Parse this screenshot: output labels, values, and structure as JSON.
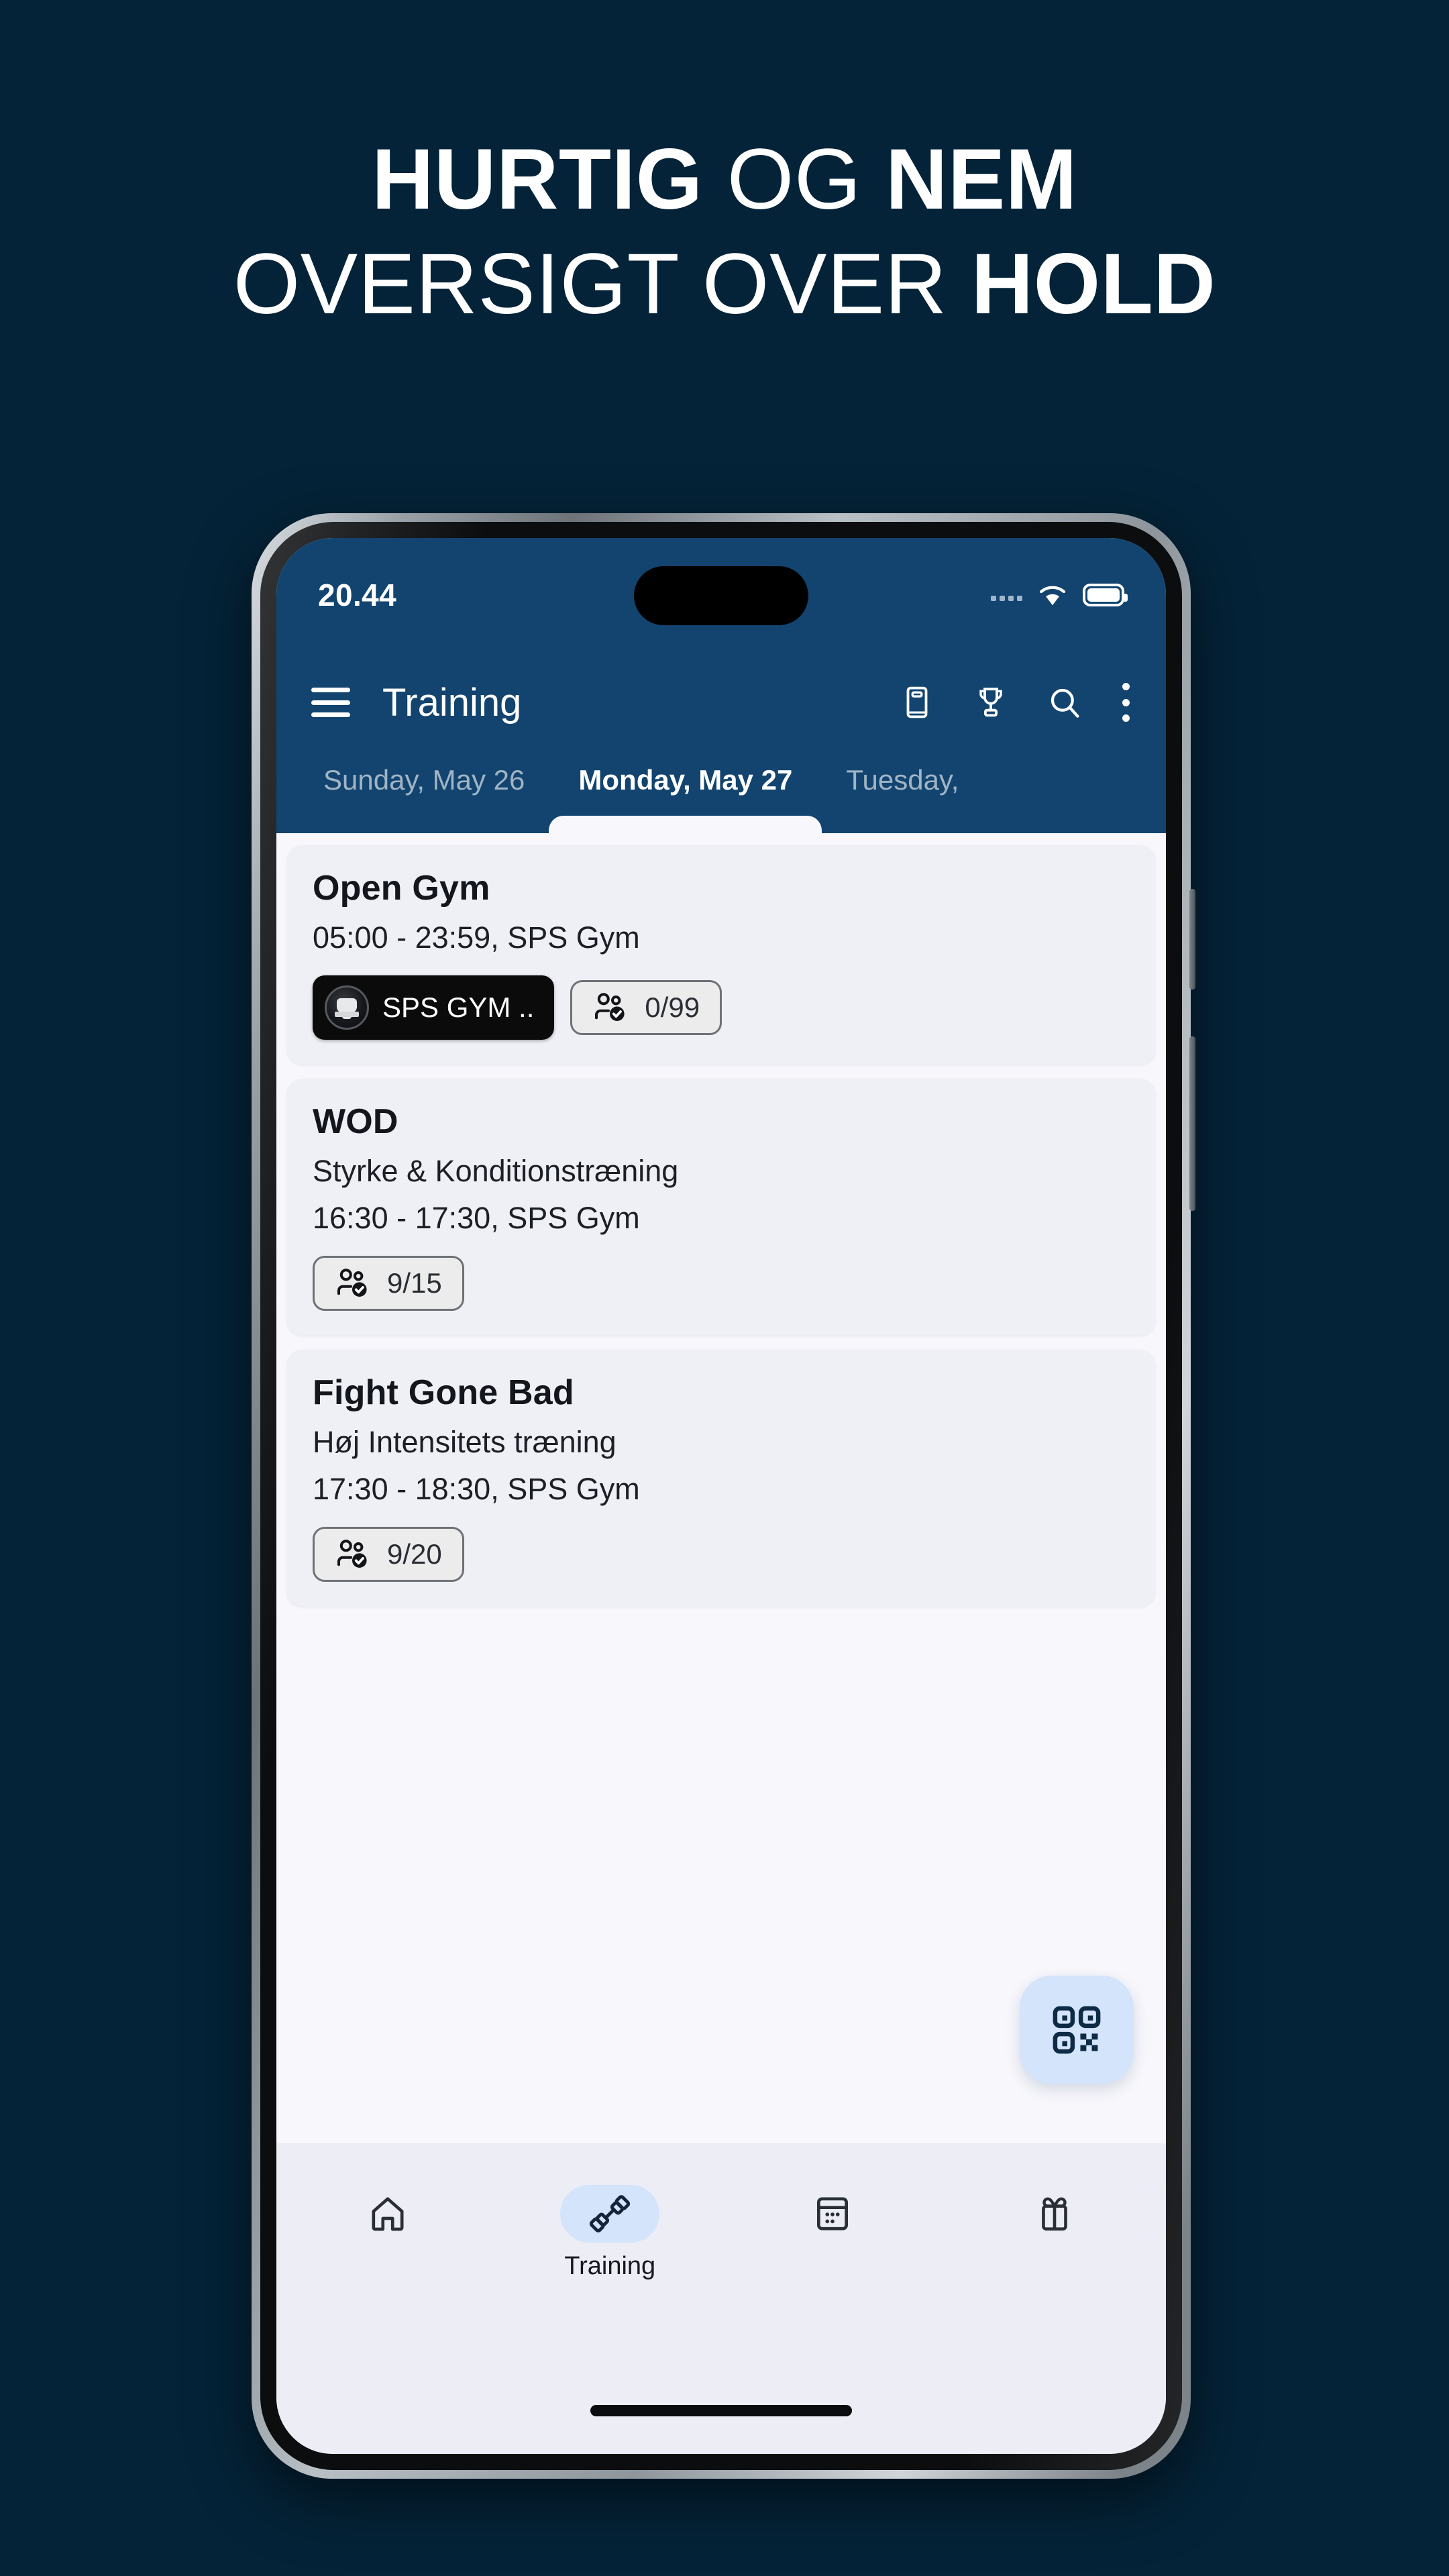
{
  "headline": {
    "line1_bold": "HURTIG",
    "line1_light": " OG ",
    "line1_bold2": "NEM",
    "line2_light": "OVERSIGT OVER ",
    "line2_bold": "HOLD"
  },
  "colors": {
    "page_background": "#042338",
    "appbar": "#12446F",
    "content_background": "#F7F7FC",
    "card_background": "#EFEFF6",
    "bottomnav_background": "#EDEDF5",
    "accent_light_blue": "#D3E4FB",
    "accent_icon_navy": "#0E2B45",
    "text_dark": "#13161C"
  },
  "statusbar": {
    "time": "20.44",
    "icons": [
      "signal-dots-icon",
      "wifi-icon",
      "battery-icon"
    ]
  },
  "appbar": {
    "menu_icon": "hamburger-menu-icon",
    "title": "Training",
    "actions": [
      {
        "icon": "journal-book-icon",
        "name": "journal-button"
      },
      {
        "icon": "trophy-icon",
        "name": "leaderboard-button"
      },
      {
        "icon": "search-icon",
        "name": "search-button"
      },
      {
        "icon": "overflow-menu-icon",
        "name": "overflow-menu-button"
      }
    ]
  },
  "date_tabs": [
    {
      "label": "Sunday, May 26",
      "active": false
    },
    {
      "label": "Monday, May 27",
      "active": true
    },
    {
      "label": "Tuesday, ",
      "active": false
    }
  ],
  "classes": [
    {
      "title": "Open Gym",
      "description": "",
      "time_location": "05:00 - 23:59, SPS Gym",
      "gym_chip": "SPS GYM ..",
      "attendance": "0/99",
      "attendance_icon": "people-check-icon"
    },
    {
      "title": "WOD",
      "description": "Styrke & Konditionstræning",
      "time_location": "16:30 - 17:30, SPS Gym",
      "gym_chip": "",
      "attendance": "9/15",
      "attendance_icon": "people-check-icon"
    },
    {
      "title": "Fight Gone Bad",
      "description": "Høj Intensitets træning",
      "time_location": "17:30 - 18:30, SPS Gym",
      "gym_chip": "",
      "attendance": "9/20",
      "attendance_icon": "people-check-icon"
    }
  ],
  "fab": {
    "icon": "qr-code-icon",
    "name": "qr-scan-button"
  },
  "bottom_nav": [
    {
      "label": "",
      "icon": "home-icon",
      "active": false,
      "name": "nav-home"
    },
    {
      "label": "Training",
      "icon": "dumbbell-icon",
      "active": true,
      "name": "nav-training"
    },
    {
      "label": "",
      "icon": "calendar-icon",
      "active": false,
      "name": "nav-calendar"
    },
    {
      "label": "",
      "icon": "gift-icon",
      "active": false,
      "name": "nav-shop"
    }
  ]
}
